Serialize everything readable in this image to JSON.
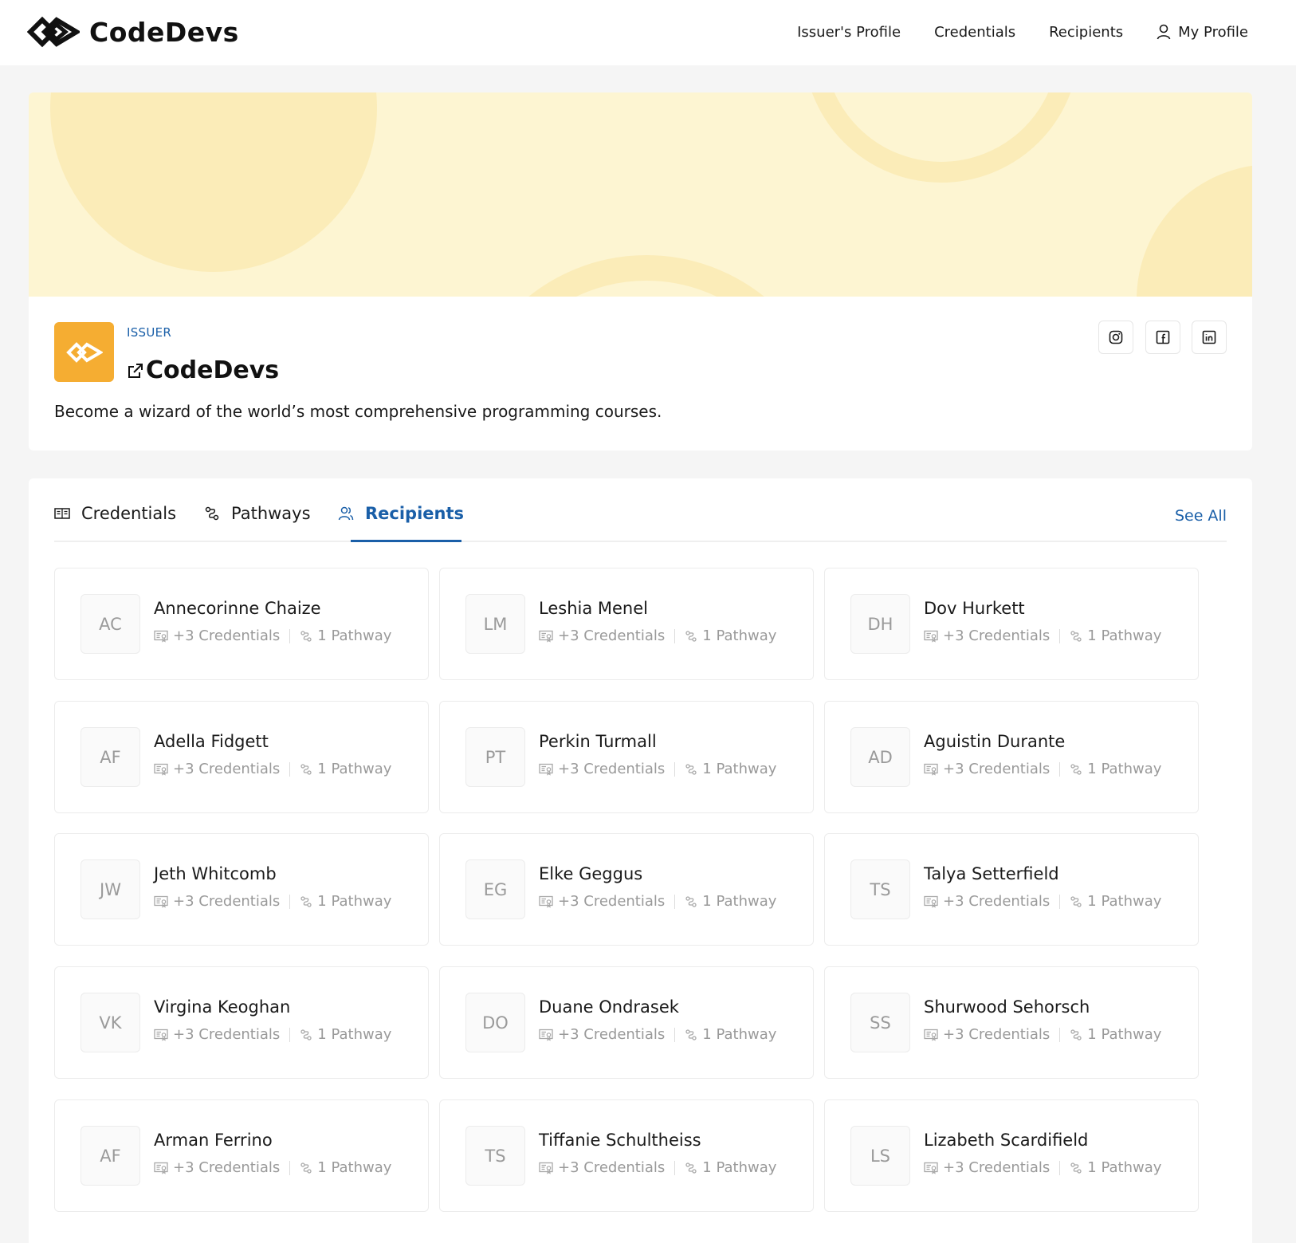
{
  "header": {
    "brand": "CodeDevs",
    "nav": {
      "issuer_profile": "Issuer's Profile",
      "credentials": "Credentials",
      "recipients": "Recipients",
      "my_profile": "My Profile"
    }
  },
  "issuer": {
    "tag": "ISSUER",
    "name": "CodeDevs",
    "description": "Become a wizard of the world’s most comprehensive programming courses.",
    "social": [
      "instagram-icon",
      "facebook-icon",
      "linkedin-icon"
    ]
  },
  "tabs": {
    "credentials": "Credentials",
    "pathways": "Pathways",
    "recipients": "Recipients",
    "active": "recipients",
    "see_all": "See All"
  },
  "recipients": [
    {
      "initials": "AC",
      "name": "Annecorinne Chaize",
      "credentials": "+3 Credentials",
      "pathway": "1 Pathway"
    },
    {
      "initials": "LM",
      "name": "Leshia Menel",
      "credentials": "+3 Credentials",
      "pathway": "1 Pathway"
    },
    {
      "initials": "DH",
      "name": "Dov Hurkett",
      "credentials": "+3 Credentials",
      "pathway": "1 Pathway"
    },
    {
      "initials": "AF",
      "name": "Adella Fidgett",
      "credentials": "+3 Credentials",
      "pathway": "1 Pathway"
    },
    {
      "initials": "PT",
      "name": "Perkin Turmall",
      "credentials": "+3 Credentials",
      "pathway": "1 Pathway"
    },
    {
      "initials": "AD",
      "name": "Aguistin Durante",
      "credentials": "+3 Credentials",
      "pathway": "1 Pathway"
    },
    {
      "initials": "JW",
      "name": "Jeth Whitcomb",
      "credentials": "+3 Credentials",
      "pathway": "1 Pathway"
    },
    {
      "initials": "EG",
      "name": "Elke Geggus",
      "credentials": "+3 Credentials",
      "pathway": "1 Pathway"
    },
    {
      "initials": "TS",
      "name": "Talya Setterfield",
      "credentials": "+3 Credentials",
      "pathway": "1 Pathway"
    },
    {
      "initials": "VK",
      "name": "Virgina Keoghan",
      "credentials": "+3 Credentials",
      "pathway": "1 Pathway"
    },
    {
      "initials": "DO",
      "name": "Duane Ondrasek",
      "credentials": "+3 Credentials",
      "pathway": "1 Pathway"
    },
    {
      "initials": "SS",
      "name": "Shurwood Sehorsch",
      "credentials": "+3 Credentials",
      "pathway": "1 Pathway"
    },
    {
      "initials": "AF",
      "name": "Arman Ferrino",
      "credentials": "+3 Credentials",
      "pathway": "1 Pathway"
    },
    {
      "initials": "TS",
      "name": "Tiffanie Schultheiss",
      "credentials": "+3 Credentials",
      "pathway": "1 Pathway"
    },
    {
      "initials": "LS",
      "name": "Lizabeth Scardifield",
      "credentials": "+3 Credentials",
      "pathway": "1 Pathway"
    }
  ],
  "colors": {
    "accent": "#1a5fa8",
    "brand_orange": "#f5ad32",
    "banner": "#fdf5d2"
  }
}
